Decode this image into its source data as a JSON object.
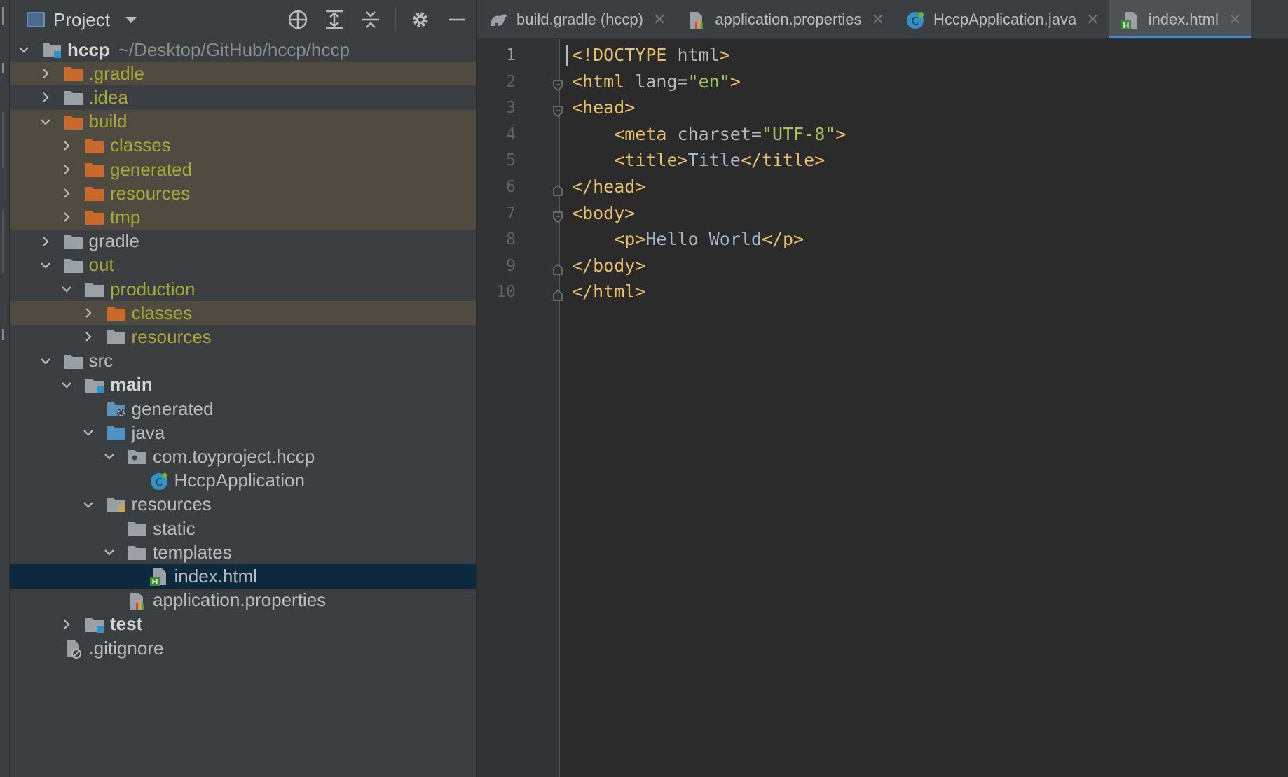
{
  "project_panel": {
    "title": "Project",
    "tools": [
      "locate-icon",
      "expand-all-icon",
      "collapse-all-icon",
      "gear-icon",
      "minimize-icon"
    ]
  },
  "tree": [
    {
      "label": "hccp",
      "path": "~/Desktop/GitHub/hccp/hccp",
      "depth": 0,
      "arrow": "down",
      "icon": "module-folder",
      "style": "bold"
    },
    {
      "label": ".gradle",
      "depth": 1,
      "arrow": "right",
      "icon": "folder-orange",
      "style": "olive",
      "ignored": true
    },
    {
      "label": ".idea",
      "depth": 1,
      "arrow": "right",
      "icon": "folder-gray",
      "style": "olive"
    },
    {
      "label": "build",
      "depth": 1,
      "arrow": "down",
      "icon": "folder-orange",
      "style": "olive",
      "ignored": true
    },
    {
      "label": "classes",
      "depth": 2,
      "arrow": "right",
      "icon": "folder-orange",
      "style": "olive",
      "ignored": true
    },
    {
      "label": "generated",
      "depth": 2,
      "arrow": "right",
      "icon": "folder-orange",
      "style": "olive",
      "ignored": true
    },
    {
      "label": "resources",
      "depth": 2,
      "arrow": "right",
      "icon": "folder-orange",
      "style": "olive",
      "ignored": true
    },
    {
      "label": "tmp",
      "depth": 2,
      "arrow": "right",
      "icon": "folder-orange",
      "style": "olive",
      "ignored": true
    },
    {
      "label": "gradle",
      "depth": 1,
      "arrow": "right",
      "icon": "folder-gray",
      "style": "normal"
    },
    {
      "label": "out",
      "depth": 1,
      "arrow": "down",
      "icon": "folder-gray",
      "style": "olive"
    },
    {
      "label": "production",
      "depth": 2,
      "arrow": "down",
      "icon": "folder-gray",
      "style": "olive"
    },
    {
      "label": "classes",
      "depth": 3,
      "arrow": "right",
      "icon": "folder-orange",
      "style": "olive",
      "ignored": true
    },
    {
      "label": "resources",
      "depth": 3,
      "arrow": "right",
      "icon": "folder-gray",
      "style": "olive"
    },
    {
      "label": "src",
      "depth": 1,
      "arrow": "down",
      "icon": "folder-gray",
      "style": "normal"
    },
    {
      "label": "main",
      "depth": 2,
      "arrow": "down",
      "icon": "module-folder",
      "style": "bold"
    },
    {
      "label": "generated",
      "depth": 3,
      "arrow": "none",
      "icon": "generated-folder",
      "style": "normal"
    },
    {
      "label": "java",
      "depth": 3,
      "arrow": "down",
      "icon": "folder-blue",
      "style": "normal"
    },
    {
      "label": "com.toyproject.hccp",
      "depth": 4,
      "arrow": "down",
      "icon": "package-folder",
      "style": "normal"
    },
    {
      "label": "HccpApplication",
      "depth": 5,
      "arrow": "none",
      "icon": "spring-class",
      "style": "normal"
    },
    {
      "label": "resources",
      "depth": 3,
      "arrow": "down",
      "icon": "resources-folder",
      "style": "normal"
    },
    {
      "label": "static",
      "depth": 4,
      "arrow": "none",
      "icon": "folder-gray",
      "style": "normal"
    },
    {
      "label": "templates",
      "depth": 4,
      "arrow": "down",
      "icon": "folder-gray",
      "style": "normal"
    },
    {
      "label": "index.html",
      "depth": 5,
      "arrow": "none",
      "icon": "html-file",
      "style": "normal",
      "selected": true
    },
    {
      "label": "application.properties",
      "depth": 4,
      "arrow": "none",
      "icon": "properties-file",
      "style": "normal"
    },
    {
      "label": "test",
      "depth": 2,
      "arrow": "right",
      "icon": "module-folder",
      "style": "bold"
    },
    {
      "label": ".gitignore",
      "depth": 1,
      "arrow": "none",
      "icon": "gitignore-file",
      "style": "normal"
    }
  ],
  "tabs": [
    {
      "label": "build.gradle (hccp)",
      "icon": "gradle-icon",
      "active": false
    },
    {
      "label": "application.properties",
      "icon": "properties-file-icon",
      "active": false
    },
    {
      "label": "HccpApplication.java",
      "icon": "spring-class-icon",
      "active": false
    },
    {
      "label": "index.html",
      "icon": "html-file-icon",
      "active": true
    }
  ],
  "code": [
    [
      [
        "tag",
        "<!DOCTYPE "
      ],
      [
        "attr",
        "html"
      ],
      [
        "tag",
        ">"
      ]
    ],
    [
      [
        "tag",
        "<html "
      ],
      [
        "attr",
        "lang="
      ],
      [
        "val",
        "\"en\""
      ],
      [
        "tag",
        ">"
      ]
    ],
    [
      [
        "tag",
        "<head>"
      ]
    ],
    [
      [
        "txt",
        "    "
      ],
      [
        "tag",
        "<meta "
      ],
      [
        "attr",
        "charset="
      ],
      [
        "val",
        "\"UTF-8\""
      ],
      [
        "tag",
        ">"
      ]
    ],
    [
      [
        "txt",
        "    "
      ],
      [
        "tag",
        "<title>"
      ],
      [
        "txt",
        "Title"
      ],
      [
        "tag",
        "</title>"
      ]
    ],
    [
      [
        "tag",
        "</head>"
      ]
    ],
    [
      [
        "tag",
        "<body>"
      ]
    ],
    [
      [
        "txt",
        "    "
      ],
      [
        "tag",
        "<p>"
      ],
      [
        "txt",
        "Hello World"
      ],
      [
        "tag",
        "</p>"
      ]
    ],
    [
      [
        "tag",
        "</body>"
      ]
    ],
    [
      [
        "tag",
        "</html>"
      ]
    ]
  ],
  "line_numbers": [
    "1",
    "2",
    "3",
    "4",
    "5",
    "6",
    "7",
    "8",
    "9",
    "10"
  ],
  "current_line": 1,
  "colors": {
    "ignored_row_bg": "#4f4b41",
    "selected_row_bg": "#0d293e",
    "olive_text": "#a8a838",
    "tag": "#e8bf6a",
    "string": "#a5c25c",
    "accent": "#4a88c7"
  }
}
